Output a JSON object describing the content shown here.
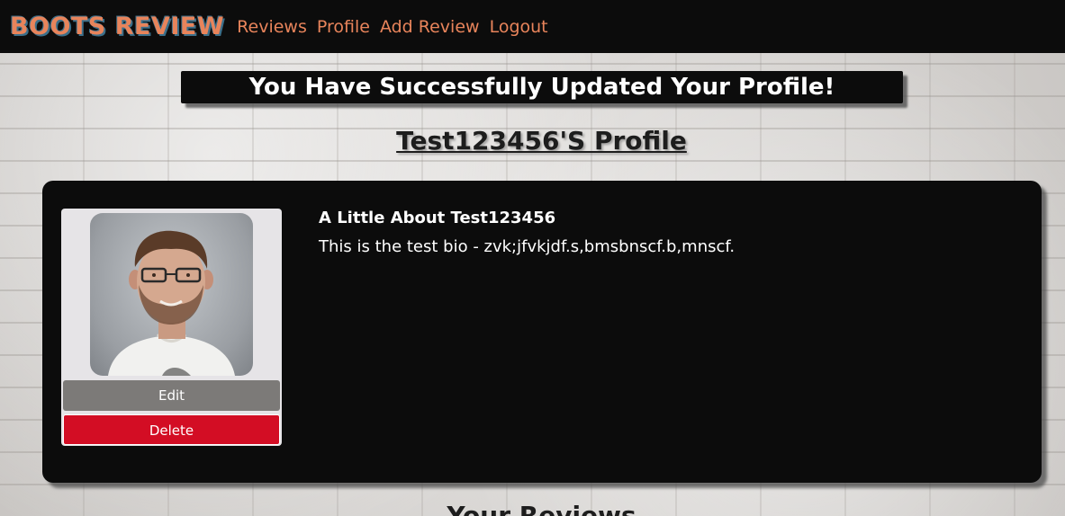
{
  "navbar": {
    "brand": "BOOTS REVIEW",
    "links": [
      "Reviews",
      "Profile",
      "Add Review",
      "Logout"
    ]
  },
  "banner": {
    "message": "You Have Successfully Updated Your Profile!"
  },
  "profile": {
    "title": "Test123456'S Profile",
    "about_heading": "A Little About Test123456",
    "bio": "This is the test bio - zvk;jfvkjdf.s,bmsbnscf.b,mnscf.",
    "edit_label": "Edit",
    "delete_label": "Delete",
    "avatar_icon": "user-photo"
  },
  "reviews": {
    "heading": "Your Reviews"
  },
  "colors": {
    "nav_bg": "#0c0c0c",
    "accent": "#e8845b",
    "delete": "#d30d24",
    "edit": "#7c7a78"
  }
}
